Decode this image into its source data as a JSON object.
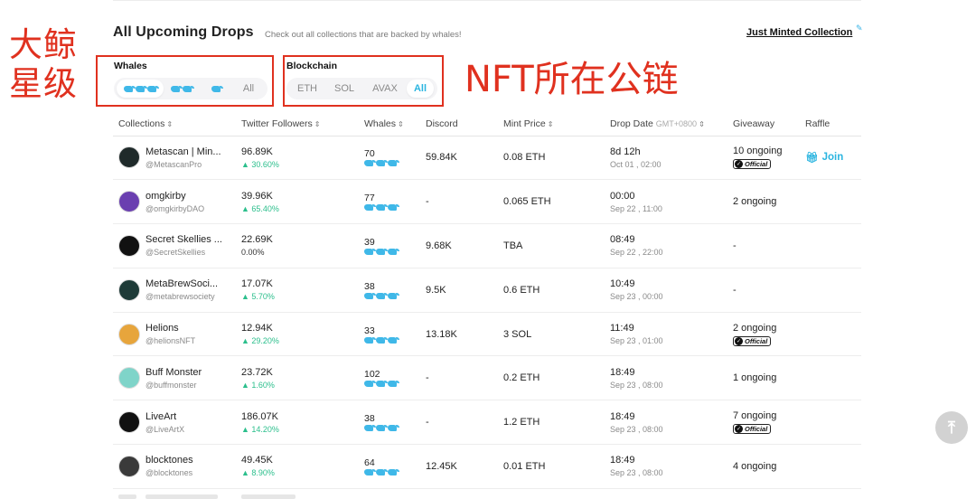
{
  "header": {
    "title": "All Upcoming Drops",
    "subtitle": "Check out all collections that are backed by whales!",
    "just_minted": "Just Minted Collection"
  },
  "annotations": {
    "whales": "大鲸星级",
    "blockchain": "NFT所在公链",
    "color": "#e0311f"
  },
  "filters": {
    "whales_label": "Whales",
    "whales_options": [
      {
        "label": "🐳🐳🐳",
        "whales": 3,
        "active": true
      },
      {
        "label": "🐳🐳",
        "whales": 2,
        "active": false
      },
      {
        "label": "🐳",
        "whales": 1,
        "active": false
      },
      {
        "label": "All",
        "active": false
      }
    ],
    "chain_label": "Blockchain",
    "chain_options": [
      {
        "label": "ETH",
        "active": false
      },
      {
        "label": "SOL",
        "active": false
      },
      {
        "label": "AVAX",
        "active": false
      },
      {
        "label": "All",
        "active": true
      }
    ]
  },
  "table": {
    "columns": {
      "collections": "Collections",
      "twitter": "Twitter Followers",
      "whales": "Whales",
      "discord": "Discord",
      "mint_price": "Mint Price",
      "drop_date": "Drop Date",
      "drop_tz": "GMT+0800",
      "giveaway": "Giveaway",
      "raffle": "Raffle"
    },
    "rows": [
      {
        "name": "Metascan | Min...",
        "handle": "@MetascanPro",
        "followers": "96.89K",
        "delta": "▲ 30.60%",
        "whales": "70",
        "discord": "59.84K",
        "price": "0.08 ETH",
        "date": "8d 12h",
        "date_sub": "Oct 01 , 02:00",
        "giveaway": "10 ongoing",
        "official": true,
        "raffle": "Join",
        "avatar_color": "#1f2a2a"
      },
      {
        "name": "omgkirby",
        "handle": "@omgkirbyDAO",
        "followers": "39.96K",
        "delta": "▲ 65.40%",
        "whales": "77",
        "discord": "-",
        "price": "0.065 ETH",
        "date": "00:00",
        "date_sub": "Sep 22 , 11:00",
        "giveaway": "2 ongoing",
        "official": false,
        "raffle": "",
        "avatar_color": "#6a3fb0"
      },
      {
        "name": "Secret Skellies ...",
        "handle": "@SecretSkellies",
        "followers": "22.69K",
        "delta": "0.00%",
        "whales": "39",
        "discord": "9.68K",
        "price": "TBA",
        "date": "08:49",
        "date_sub": "Sep 22 , 22:00",
        "giveaway": "-",
        "official": false,
        "raffle": "",
        "avatar_color": "#111111"
      },
      {
        "name": "MetaBrewSoci...",
        "handle": "@metabrewsociety",
        "followers": "17.07K",
        "delta": "▲ 5.70%",
        "whales": "38",
        "discord": "9.5K",
        "price": "0.6 ETH",
        "date": "10:49",
        "date_sub": "Sep 23 , 00:00",
        "giveaway": "-",
        "official": false,
        "raffle": "",
        "avatar_color": "#1e3b38"
      },
      {
        "name": "Helions",
        "handle": "@helionsNFT",
        "followers": "12.94K",
        "delta": "▲ 29.20%",
        "whales": "33",
        "discord": "13.18K",
        "price": "3 SOL",
        "date": "11:49",
        "date_sub": "Sep 23 , 01:00",
        "giveaway": "2 ongoing",
        "official": true,
        "raffle": "",
        "avatar_color": "#e7a53c"
      },
      {
        "name": "Buff Monster",
        "handle": "@buffmonster",
        "followers": "23.72K",
        "delta": "▲ 1.60%",
        "whales": "102",
        "discord": "-",
        "price": "0.2 ETH",
        "date": "18:49",
        "date_sub": "Sep 23 , 08:00",
        "giveaway": "1 ongoing",
        "official": false,
        "raffle": "",
        "avatar_color": "#7fd4c9"
      },
      {
        "name": "LiveArt",
        "handle": "@LiveArtX",
        "followers": "186.07K",
        "delta": "▲ 14.20%",
        "whales": "38",
        "discord": "-",
        "price": "1.2 ETH",
        "date": "18:49",
        "date_sub": "Sep 23 , 08:00",
        "giveaway": "7 ongoing",
        "official": true,
        "raffle": "",
        "avatar_color": "#111111"
      },
      {
        "name": "blocktones",
        "handle": "@blocktones",
        "followers": "49.45K",
        "delta": "▲ 8.90%",
        "whales": "64",
        "discord": "12.45K",
        "price": "0.01 ETH",
        "date": "18:49",
        "date_sub": "Sep 23 , 08:00",
        "giveaway": "4 ongoing",
        "official": false,
        "raffle": "",
        "avatar_color": "#3a3a3a"
      }
    ]
  },
  "badge": {
    "official_label": "Official"
  },
  "colors": {
    "accent": "#2bb5e0",
    "positive": "#2bbf8c",
    "text": "#222222"
  }
}
